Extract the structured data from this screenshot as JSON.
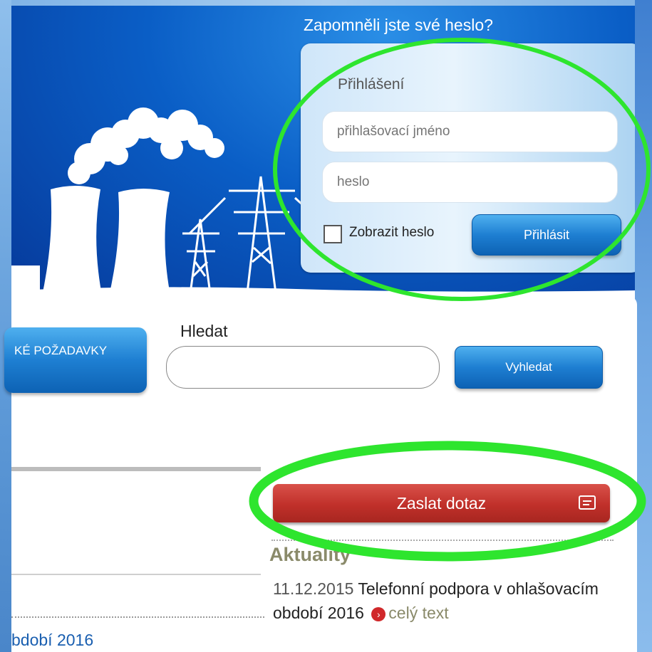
{
  "header": {
    "forgot_password": "Zapomněli jste své heslo?"
  },
  "login": {
    "title": "Přihlášení",
    "username_placeholder": "přihlašovací jméno",
    "password_placeholder": "heslo",
    "show_password_label": "Zobrazit heslo",
    "submit_label": "Přihlásit"
  },
  "nav": {
    "special_requests_label": "KÉ POŽADAVKY"
  },
  "search": {
    "label": "Hledat",
    "button_label": "Vyhledat"
  },
  "contact": {
    "ask_label": "Zaslat dotaz",
    "icon": "message-icon"
  },
  "news": {
    "heading": "Aktuality",
    "items": [
      {
        "date": "11.12.2015",
        "title": "Telefonní podpora v ohlašovacím období 2016",
        "more": "celý text"
      }
    ],
    "left_snippet": "bdobí 2016"
  },
  "colors": {
    "header_blue": "#0a5ec6",
    "button_blue": "#1e7fd2",
    "ask_red": "#c0302a",
    "highlight_green": "#2ee52e"
  }
}
